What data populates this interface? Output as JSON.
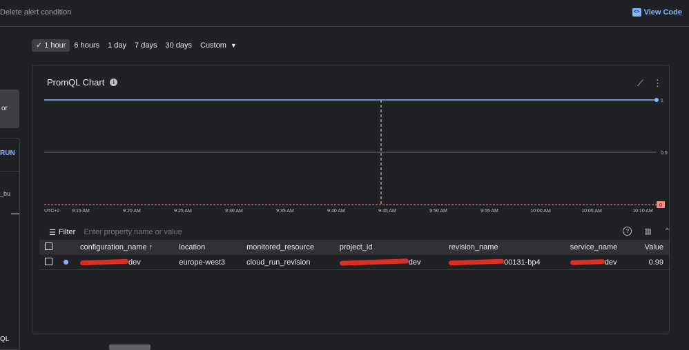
{
  "topbar": {
    "delete_label": "Delete alert condition",
    "view_code_label": "View Code"
  },
  "left": {
    "panel_text": "or",
    "run_text": "RUN",
    "bu_text": "_bu",
    "promql_text": "QL"
  },
  "time_range": {
    "options": [
      "1 hour",
      "6 hours",
      "1 day",
      "7 days",
      "30 days",
      "Custom"
    ],
    "selected": "1 hour"
  },
  "chart": {
    "title": "PromQL Chart",
    "timezone": "UTC+2",
    "x_ticks": [
      "9:15 AM",
      "9:20 AM",
      "9:25 AM",
      "9:30 AM",
      "9:35 AM",
      "9:40 AM",
      "9:45 AM",
      "9:50 AM",
      "9:55 AM",
      "10:00 AM",
      "10:05 AM",
      "10:10 AM"
    ],
    "y_ticks": [
      "1",
      "0.5",
      "0"
    ],
    "line_color": "#8ab4f8",
    "threshold_color": "#f28b82"
  },
  "chart_data": {
    "type": "line",
    "x": [
      "9:15 AM",
      "9:20 AM",
      "9:25 AM",
      "9:30 AM",
      "9:35 AM",
      "9:40 AM",
      "9:45 AM",
      "9:50 AM",
      "9:55 AM",
      "10:00 AM",
      "10:05 AM",
      "10:10 AM"
    ],
    "series": [
      {
        "values": [
          1,
          1,
          1,
          1,
          1,
          1,
          1,
          1,
          1,
          1,
          1,
          1
        ]
      }
    ],
    "ylim": [
      0,
      1
    ],
    "threshold": 0,
    "xlabel": "UTC+2",
    "ylabel": ""
  },
  "filter": {
    "label": "Filter",
    "placeholder": "Enter property name or value"
  },
  "table": {
    "columns": [
      "configuration_name",
      "location",
      "monitored_resource",
      "project_id",
      "revision_name",
      "service_name",
      "Value"
    ],
    "rows": [
      {
        "configuration_name": "dev",
        "location": "europe-west3",
        "monitored_resource": "cloud_run_revision",
        "project_id": "dev",
        "revision_name": "00131-bp4",
        "service_name": "dev",
        "value": "0.99"
      }
    ]
  }
}
